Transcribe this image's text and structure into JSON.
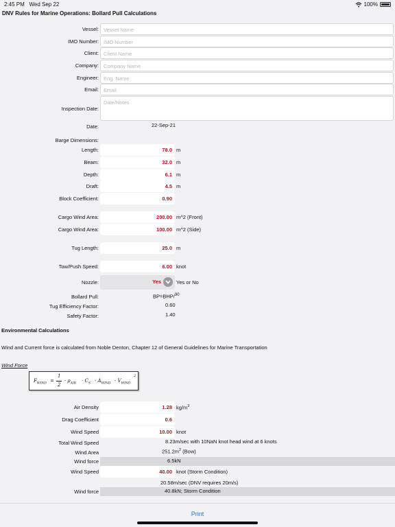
{
  "status": {
    "time": "2:45 PM",
    "date": "Wed Sep 22",
    "battery": "100%"
  },
  "title": "DNV Rules for Marine Operations: Bollard Pull Calculations",
  "fields": {
    "vessel": {
      "label": "Vessel:",
      "placeholder": "Vessel Name"
    },
    "imo": {
      "label": "IMO Number:",
      "placeholder": "IMO Number"
    },
    "client": {
      "label": "Client:",
      "placeholder": "Client Name"
    },
    "company": {
      "label": "Company:",
      "placeholder": "Company Name"
    },
    "engineer": {
      "label": "Engineer:",
      "placeholder": "Eng. Name"
    },
    "email": {
      "label": "Email:",
      "placeholder": "Email"
    },
    "inspection": {
      "label": "Inspection Date:",
      "placeholder": "Date/Notes"
    }
  },
  "date": {
    "label": "Date:",
    "value": "22-Sep-21"
  },
  "barge": {
    "heading": "Barge Dimensions:",
    "length": {
      "label": "Length:",
      "value": "78.0",
      "unit": "m"
    },
    "beam": {
      "label": "Beam:",
      "value": "32.0",
      "unit": "m"
    },
    "depth": {
      "label": "Depth:",
      "value": "6.1",
      "unit": "m"
    },
    "draft": {
      "label": "Draft:",
      "value": "4.5",
      "unit": "m"
    },
    "block": {
      "label": "Block Coefficient:",
      "value": "0.90"
    }
  },
  "cargo": {
    "front": {
      "label": "Cargo Wind Area:",
      "value": "200.00",
      "unit": "m^2 (Front)"
    },
    "side": {
      "label": "Cargo Wind Area:",
      "value": "100.00",
      "unit": "m^2 (Side)"
    }
  },
  "tug": {
    "length": {
      "label": "Tug Length:",
      "value": "25.0",
      "unit": "m"
    },
    "speed": {
      "label": "Tow/Push Speed:",
      "value": "6.00",
      "unit": "knot"
    },
    "nozzle": {
      "label": "Nozzle:",
      "value": "Yes",
      "unit": "Yes or No"
    },
    "bollard": {
      "label": "Bollard Pull:",
      "value": "BP=BHP/",
      "sup": "90"
    },
    "efficiency": {
      "label": "Tug Efficiency Factor:",
      "value": "0.60"
    },
    "safety": {
      "label": "Safety Factor:",
      "value": "1.40"
    }
  },
  "env": {
    "heading": "Environmental Calculations",
    "note": "Wind and Current force is calculated from Noble Denton, Chapter 12 of General Guidelines for Marine Transportation",
    "wind_force_heading": "Wind Force"
  },
  "formula": {
    "lhs": "F",
    "lhs_sub": "WIND",
    "eq": "=",
    "num": "1",
    "den": "2",
    "rho": "· ρ",
    "rho_sub": "AIR",
    "c": "· C",
    "c_sub": "S",
    "a": "· A",
    "a_sub": "WIND",
    "v": "· V",
    "v_sub": "WIND",
    "exp": "2"
  },
  "wind": {
    "air": {
      "label": "Air Density",
      "value": "1.28",
      "unit": "kg/m",
      "unit_sup": "3"
    },
    "drag": {
      "label": "Drag Coefficient",
      "value": "0.6"
    },
    "speed": {
      "label": "Wind Speed",
      "value": "10.00",
      "unit": "knot"
    },
    "total": {
      "label": "Total Wind Speed",
      "value": "8.23m/sec with 10NaN knot head wind at 6 knots"
    },
    "area": {
      "label": "Wind Area",
      "value": "251.2",
      "unit": "m",
      "unit_sup": "2",
      "unit_tail": " (Bow)"
    },
    "force": {
      "label": "Wind force",
      "value": "6.5",
      "unit": "kN"
    },
    "storm_speed": {
      "label": "Wind Speed",
      "value": "40.00",
      "unit": "knot (Storm Condition)"
    },
    "storm_ms": {
      "value": "20.58",
      "unit": "m/sec (DNV requires 20m/s)"
    },
    "storm_force": {
      "label": "Wind force",
      "value": "40.8",
      "unit": "kN; Storm Condition"
    }
  },
  "print_label": "Print"
}
